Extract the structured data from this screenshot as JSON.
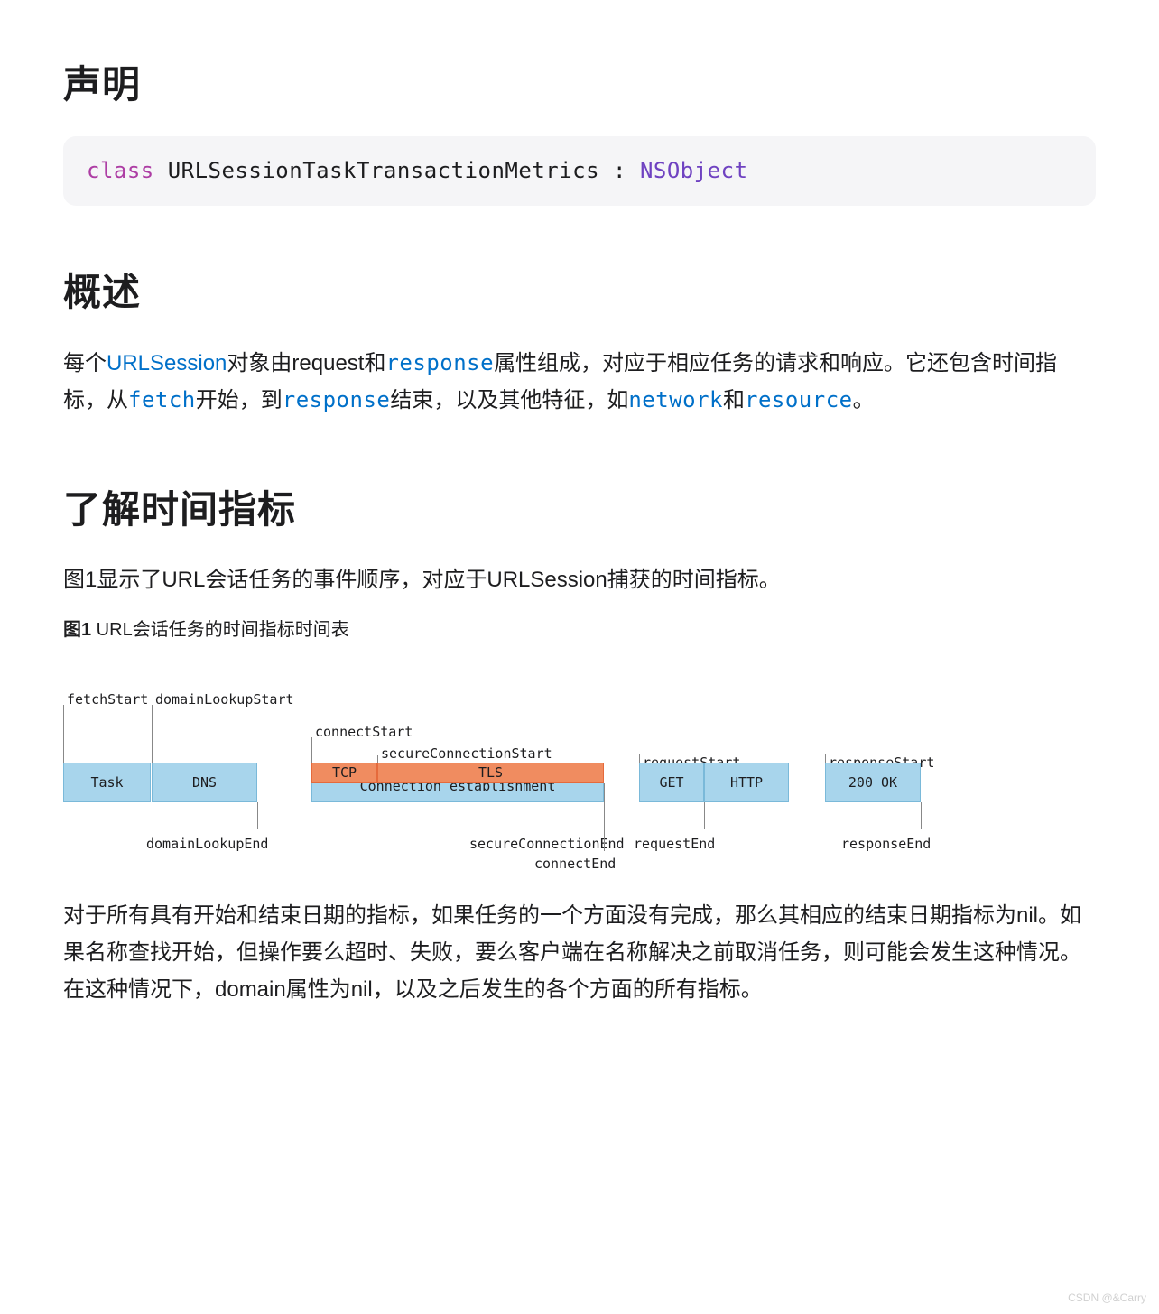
{
  "sections": {
    "declaration_title": "声明",
    "overview_title": "概述",
    "timing_title": "了解时间指标"
  },
  "code": {
    "class_kw": "class",
    "class_name": " URLSessionTaskTransactionMetrics ",
    "colon": ": ",
    "super_name": "NSObject"
  },
  "overview": {
    "p1_a": "每个",
    "link_urlsession": "URLSession",
    "p1_b": "对象由request和",
    "link_response": "response",
    "p1_c": "属性组成，对应于相应任务的请求和响应。它还包含时间指标，从",
    "link_fetch": "fetch",
    "p1_d": "开始，到",
    "link_response2": "response",
    "p1_e": "结束，以及其他特征，如",
    "link_network": "network",
    "p1_f": "和",
    "link_resource": "resource",
    "p1_g": "。"
  },
  "timing": {
    "intro": "图1显示了URL会话任务的事件顺序，对应于URLSession捕获的时间指标。",
    "fig_label": "图1",
    "fig_caption": " URL会话任务的时间指标时间表",
    "after": "对于所有具有开始和结束日期的指标，如果任务的一个方面没有完成，那么其相应的结束日期指标为nil。如果名称查找开始，但操作要么超时、失败，要么客户端在名称解决之前取消任务，则可能会发生这种情况。在这种情况下，domain属性为nil，以及之后发生的各个方面的所有指标。"
  },
  "timeline": {
    "fetchStart": "fetchStart",
    "domainLookupStart": "domainLookupStart",
    "domainLookupEnd": "domainLookupEnd",
    "connectStart": "connectStart",
    "secureConnectionStart": "secureConnectionStart",
    "secureConnectionEnd": "secureConnectionEnd",
    "connectEnd": "connectEnd",
    "requestStart": "requestStart",
    "requestEnd": "requestEnd",
    "responseStart": "responseStart",
    "responseEnd": "responseEnd",
    "task": "Task",
    "dns": "DNS",
    "tcp": "TCP",
    "tls": "TLS",
    "conn_est": "Connection establishment",
    "get": "GET",
    "http": "HTTP",
    "ok200": "200 OK"
  },
  "watermark": "CSDN @&Carry"
}
